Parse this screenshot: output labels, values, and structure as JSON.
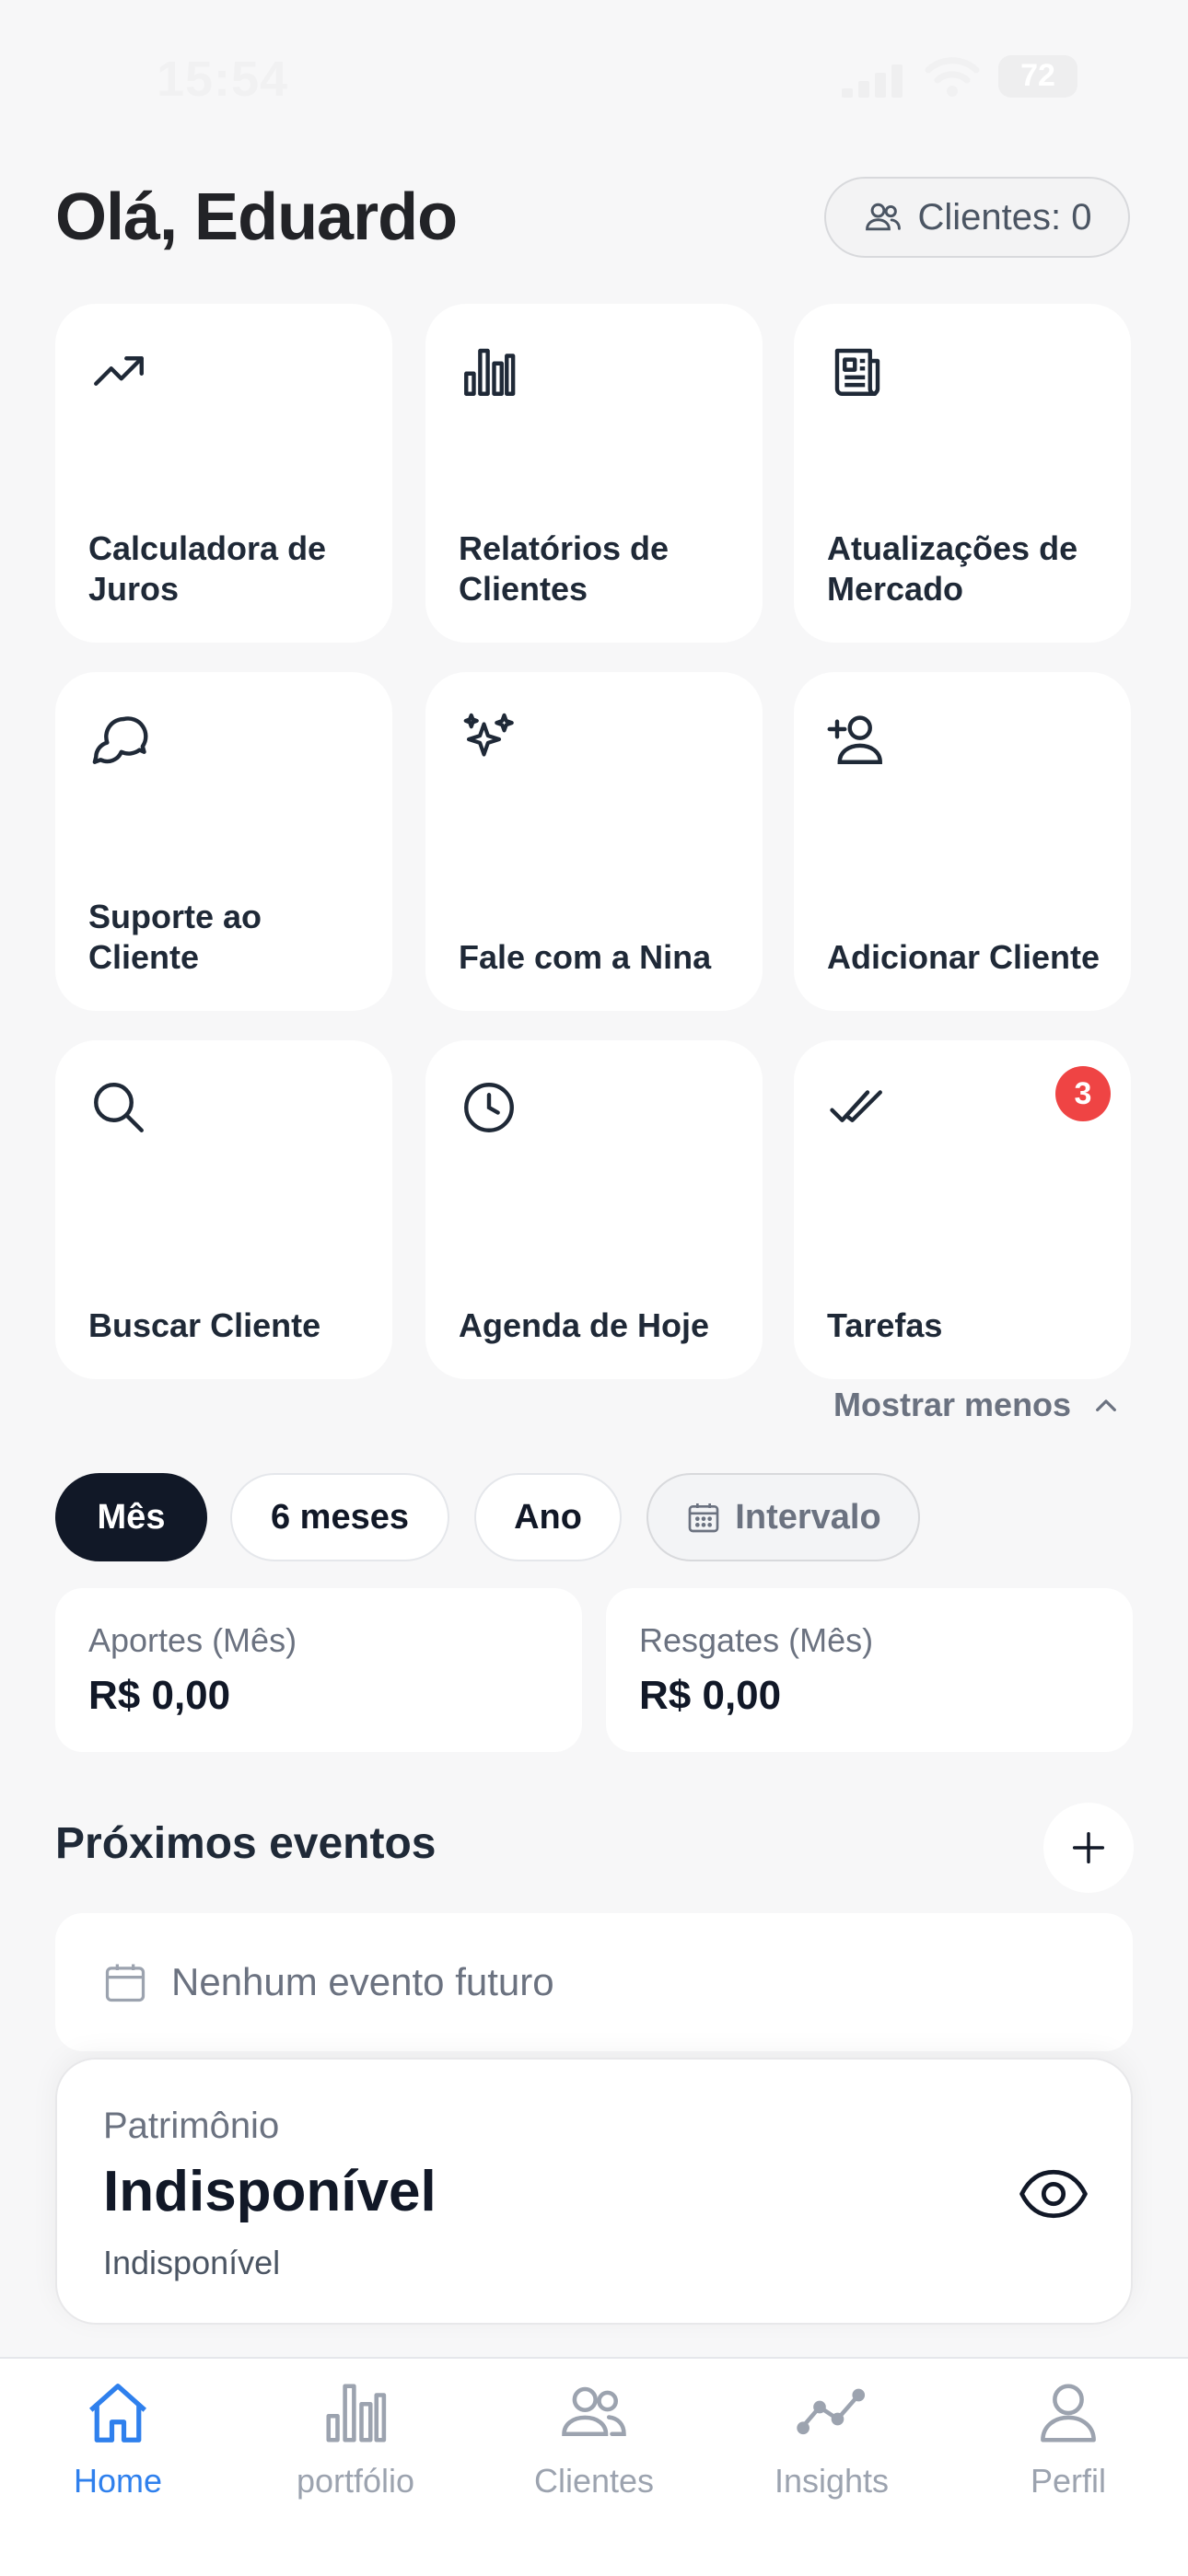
{
  "status_bar": {
    "time": "15:54",
    "battery": "72"
  },
  "header": {
    "greeting": "Olá, Eduardo",
    "clients_pill": "Clientes: 0"
  },
  "tiles": [
    {
      "label": "Calculadora de Juros",
      "icon": "trending-up-icon"
    },
    {
      "label": "Relatórios de Clientes",
      "icon": "bar-chart-icon"
    },
    {
      "label": "Atualizações de Mercado",
      "icon": "newspaper-icon"
    },
    {
      "label": "Suporte ao Cliente",
      "icon": "chat-bubbles-icon"
    },
    {
      "label": "Fale com a Nina",
      "icon": "sparkles-icon"
    },
    {
      "label": "Adicionar Cliente",
      "icon": "user-plus-icon"
    },
    {
      "label": "Buscar Cliente",
      "icon": "search-icon"
    },
    {
      "label": "Agenda de Hoje",
      "icon": "clock-icon"
    },
    {
      "label": "Tarefas",
      "icon": "double-check-icon",
      "badge": "3"
    }
  ],
  "show_less": "Mostrar menos",
  "period_filters": {
    "month": "Mês",
    "six_months": "6 meses",
    "year": "Ano",
    "interval": "Intervalo"
  },
  "stats": {
    "aportes": {
      "label": "Aportes (Mês)",
      "value": "R$ 0,00"
    },
    "resgates": {
      "label": "Resgates (Mês)",
      "value": "R$ 0,00"
    }
  },
  "events": {
    "title": "Próximos eventos",
    "empty_text": "Nenhum evento futuro"
  },
  "patrimonio": {
    "label": "Patrimônio",
    "value": "Indisponível",
    "sub": "Indisponível"
  },
  "tabbar": [
    {
      "label": "Home",
      "icon": "home-icon",
      "active": true
    },
    {
      "label": "portfólio",
      "icon": "bar-chart-icon"
    },
    {
      "label": "Clientes",
      "icon": "users-icon"
    },
    {
      "label": "Insights",
      "icon": "line-chart-icon"
    },
    {
      "label": "Perfil",
      "icon": "user-icon"
    }
  ],
  "colors": {
    "accent": "#2f80ed",
    "dark_chip": "#111827",
    "badge": "#ef4444"
  }
}
